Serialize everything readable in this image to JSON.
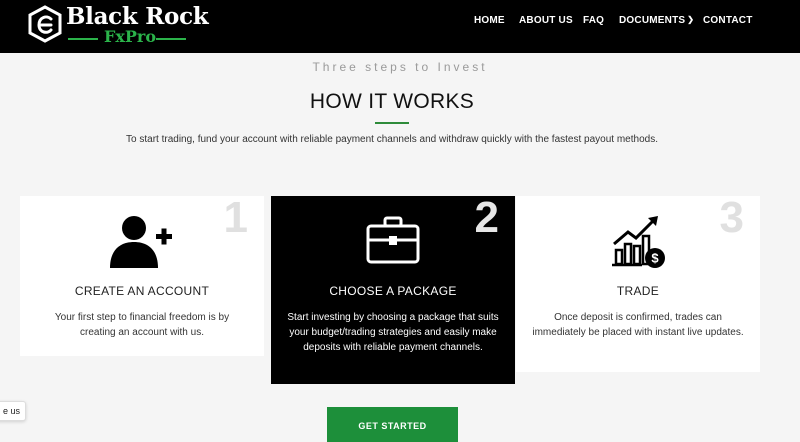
{
  "brand": {
    "name": "Black Rock",
    "sub": "FxPro"
  },
  "nav": [
    {
      "label": "HOME"
    },
    {
      "label": "ABOUT US"
    },
    {
      "label": "FAQ"
    },
    {
      "label": "DOCUMENTS",
      "has_dropdown": true
    },
    {
      "label": "CONTACT"
    }
  ],
  "section": {
    "eyebrow": "Three steps to Invest",
    "title": "HOW IT WORKS",
    "intro": "To start trading, fund your account with reliable payment channels and withdraw quickly with the fastest payout methods."
  },
  "steps": [
    {
      "number": "1",
      "icon": "add-user-icon",
      "title": "CREATE AN ACCOUNT",
      "text": "Your first step to financial freedom is by creating an account with us."
    },
    {
      "number": "2",
      "icon": "briefcase-icon",
      "title": "CHOOSE A PACKAGE",
      "text": "Start investing by choosing a package that suits your budget/trading strategies and easily make deposits with reliable payment channels."
    },
    {
      "number": "3",
      "icon": "growth-chart-icon",
      "title": "TRADE",
      "text": "Once deposit is confirmed, trades can immediately be placed with instant live updates."
    }
  ],
  "cta": {
    "label": "GET STARTED"
  },
  "chat_tab": {
    "label": "e us"
  },
  "colors": {
    "accent": "#1d8f3a",
    "header_bg": "#000000",
    "logo_green": "#2bb34a"
  }
}
